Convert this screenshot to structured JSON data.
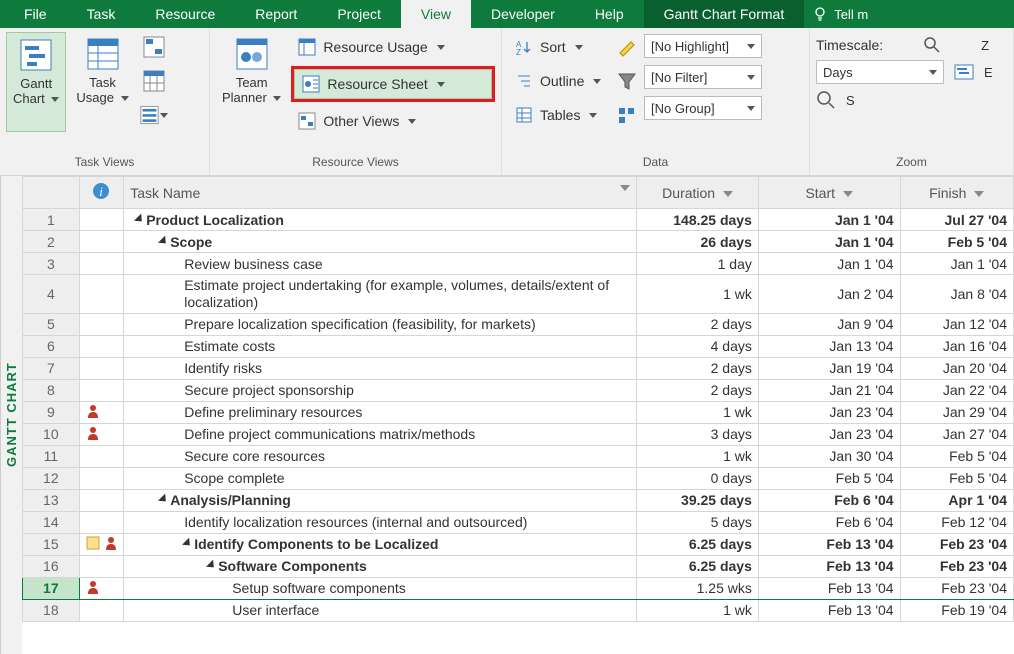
{
  "tabs": [
    "File",
    "Task",
    "Resource",
    "Report",
    "Project",
    "View",
    "Developer",
    "Help",
    "Gantt Chart Format"
  ],
  "active_tab": "View",
  "tellme": "Tell m",
  "ribbon": {
    "task_views": {
      "label": "Task Views",
      "gantt": "Gantt\nChart",
      "task_usage": "Task\nUsage"
    },
    "resource_views": {
      "label": "Resource Views",
      "team_planner": "Team\nPlanner",
      "resource_usage": "Resource Usage",
      "resource_sheet": "Resource Sheet",
      "other_views": "Other Views"
    },
    "data": {
      "label": "Data",
      "sort": "Sort",
      "outline": "Outline",
      "tables": "Tables",
      "highlight": "[No Highlight]",
      "filter": "[No Filter]",
      "group": "[No Group]"
    },
    "zoom": {
      "label": "Zoom",
      "timescale_label": "Timescale:",
      "timescale_value": "Days"
    }
  },
  "sidebar_label": "GANTT CHART",
  "columns": {
    "task_name": "Task Name",
    "duration": "Duration",
    "start": "Start",
    "finish": "Finish"
  },
  "rows": [
    {
      "n": 1,
      "ind": "",
      "name": "Product Localization",
      "dur": "148.25 days",
      "start": "Jan 1 '04",
      "finish": "Jul 27 '04",
      "bold": true,
      "indent": 0,
      "summary": true
    },
    {
      "n": 2,
      "ind": "",
      "name": "Scope",
      "dur": "26 days",
      "start": "Jan 1 '04",
      "finish": "Feb 5 '04",
      "bold": true,
      "indent": 1,
      "summary": true
    },
    {
      "n": 3,
      "ind": "",
      "name": "Review business case",
      "dur": "1 day",
      "start": "Jan 1 '04",
      "finish": "Jan 1 '04",
      "indent": 2
    },
    {
      "n": 4,
      "ind": "",
      "name": "Estimate project undertaking (for example, volumes, details/extent of localization)",
      "dur": "1 wk",
      "start": "Jan 2 '04",
      "finish": "Jan 8 '04",
      "indent": 2,
      "wrap": true
    },
    {
      "n": 5,
      "ind": "",
      "name": "Prepare localization specification (feasibility, for markets)",
      "dur": "2 days",
      "start": "Jan 9 '04",
      "finish": "Jan 12 '04",
      "indent": 2
    },
    {
      "n": 6,
      "ind": "",
      "name": "Estimate costs",
      "dur": "4 days",
      "start": "Jan 13 '04",
      "finish": "Jan 16 '04",
      "indent": 2
    },
    {
      "n": 7,
      "ind": "",
      "name": "Identify risks",
      "dur": "2 days",
      "start": "Jan 19 '04",
      "finish": "Jan 20 '04",
      "indent": 2
    },
    {
      "n": 8,
      "ind": "",
      "name": "Secure project sponsorship",
      "dur": "2 days",
      "start": "Jan 21 '04",
      "finish": "Jan 22 '04",
      "indent": 2
    },
    {
      "n": 9,
      "ind": "person",
      "name": "Define preliminary resources",
      "dur": "1 wk",
      "start": "Jan 23 '04",
      "finish": "Jan 29 '04",
      "indent": 2
    },
    {
      "n": 10,
      "ind": "person",
      "name": "Define project communications matrix/methods",
      "dur": "3 days",
      "start": "Jan 23 '04",
      "finish": "Jan 27 '04",
      "indent": 2
    },
    {
      "n": 11,
      "ind": "",
      "name": "Secure core resources",
      "dur": "1 wk",
      "start": "Jan 30 '04",
      "finish": "Feb 5 '04",
      "indent": 2
    },
    {
      "n": 12,
      "ind": "",
      "name": "Scope complete",
      "dur": "0 days",
      "start": "Feb 5 '04",
      "finish": "Feb 5 '04",
      "indent": 2
    },
    {
      "n": 13,
      "ind": "",
      "name": "Analysis/Planning",
      "dur": "39.25 days",
      "start": "Feb 6 '04",
      "finish": "Apr 1 '04",
      "bold": true,
      "indent": 1,
      "summary": true
    },
    {
      "n": 14,
      "ind": "",
      "name": "Identify localization resources (internal and outsourced)",
      "dur": "5 days",
      "start": "Feb 6 '04",
      "finish": "Feb 12 '04",
      "indent": 2
    },
    {
      "n": 15,
      "ind": "note-person",
      "name": "Identify Components to be Localized",
      "dur": "6.25 days",
      "start": "Feb 13 '04",
      "finish": "Feb 23 '04",
      "bold": true,
      "indent": 2,
      "summary": true
    },
    {
      "n": 16,
      "ind": "",
      "name": "Software Components",
      "dur": "6.25 days",
      "start": "Feb 13 '04",
      "finish": "Feb 23 '04",
      "bold": true,
      "indent": 3,
      "summary": true
    },
    {
      "n": 17,
      "ind": "person",
      "name": "Setup software components",
      "dur": "1.25 wks",
      "start": "Feb 13 '04",
      "finish": "Feb 23 '04",
      "indent": 4,
      "selected": true
    },
    {
      "n": 18,
      "ind": "",
      "name": "User interface",
      "dur": "1 wk",
      "start": "Feb 13 '04",
      "finish": "Feb 19 '04",
      "indent": 4
    }
  ]
}
